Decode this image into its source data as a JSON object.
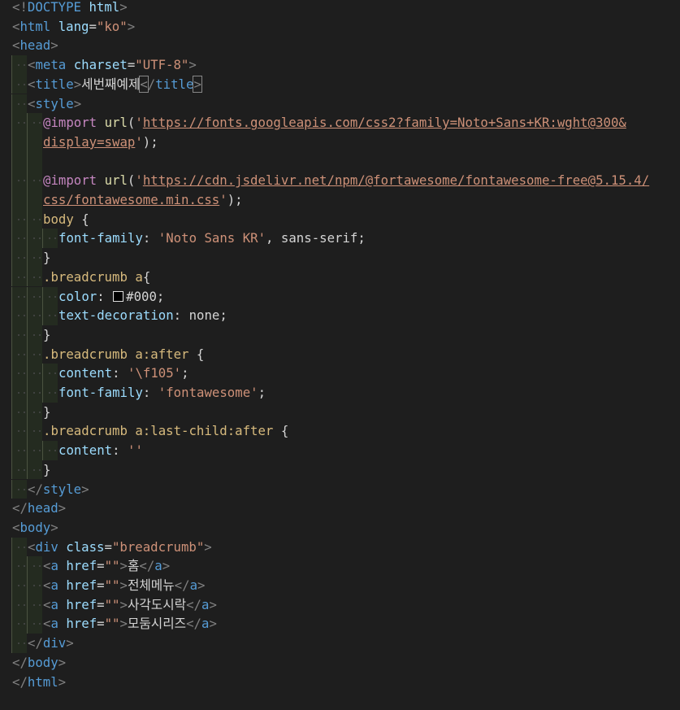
{
  "editor": {
    "language": "html",
    "theme_background": "#1e1e1e",
    "colors": {
      "tag": "#569cd6",
      "attribute": "#9cdcfe",
      "string": "#ce9178",
      "at_rule": "#c586c0",
      "function": "#dcdcaa",
      "selector": "#d7ba7d",
      "punctuation": "#808080"
    },
    "lines": [
      {
        "indent": 0,
        "tokens": [
          [
            "p",
            "<!"
          ],
          [
            "t",
            "DOCTYPE"
          ],
          [
            "x",
            " "
          ],
          [
            "a",
            "html"
          ],
          [
            "p",
            ">"
          ]
        ]
      },
      {
        "indent": 0,
        "tokens": [
          [
            "p",
            "<"
          ],
          [
            "t",
            "html"
          ],
          [
            "x",
            " "
          ],
          [
            "a",
            "lang"
          ],
          [
            "x",
            "="
          ],
          [
            "s",
            "\"ko\""
          ],
          [
            "p",
            ">"
          ]
        ]
      },
      {
        "indent": 0,
        "tokens": [
          [
            "p",
            "<"
          ],
          [
            "t",
            "head"
          ],
          [
            "p",
            ">"
          ]
        ]
      },
      {
        "indent": 1,
        "tokens": [
          [
            "p",
            "<"
          ],
          [
            "t",
            "meta"
          ],
          [
            "x",
            " "
          ],
          [
            "a",
            "charset"
          ],
          [
            "x",
            "="
          ],
          [
            "s",
            "\"UTF-8\""
          ],
          [
            "p",
            ">"
          ]
        ]
      },
      {
        "indent": 1,
        "tokens": [
          [
            "p",
            "<"
          ],
          [
            "t",
            "title"
          ],
          [
            "p",
            ">"
          ],
          [
            "x",
            "세번째예제"
          ],
          [
            "pb",
            "<"
          ],
          [
            "p",
            "/"
          ],
          [
            "t",
            "title"
          ],
          [
            "pb",
            ">"
          ],
          [
            "cur",
            ""
          ]
        ]
      },
      {
        "indent": 1,
        "tokens": [
          [
            "p",
            "<"
          ],
          [
            "t",
            "style"
          ],
          [
            "p",
            ">"
          ]
        ]
      },
      {
        "indent": 2,
        "tokens": [
          [
            "k",
            "@import"
          ],
          [
            "x",
            " "
          ],
          [
            "f",
            "url"
          ],
          [
            "x",
            "("
          ],
          [
            "s",
            "'"
          ],
          [
            "su",
            "https://fonts.googleapis.com/css2?family=Noto+Sans+KR:wght@300&"
          ]
        ]
      },
      {
        "indent": 2,
        "wrap": true,
        "tokens": [
          [
            "su",
            "display=swap"
          ],
          [
            "s",
            "'"
          ],
          [
            "x",
            ");"
          ]
        ]
      },
      {
        "indent": 2,
        "empty": true,
        "tokens": []
      },
      {
        "indent": 2,
        "tokens": [
          [
            "k",
            "@import"
          ],
          [
            "x",
            " "
          ],
          [
            "f",
            "url"
          ],
          [
            "x",
            "("
          ],
          [
            "s",
            "'"
          ],
          [
            "su",
            "https://cdn.jsdelivr.net/npm/@fortawesome/fontawesome-free@5.15.4/"
          ]
        ]
      },
      {
        "indent": 2,
        "wrap": true,
        "tokens": [
          [
            "su",
            "css/fontawesome.min.css"
          ],
          [
            "s",
            "'"
          ],
          [
            "x",
            ");"
          ]
        ]
      },
      {
        "indent": 2,
        "tokens": [
          [
            "c",
            "body"
          ],
          [
            "x",
            " {"
          ]
        ]
      },
      {
        "indent": 3,
        "tokens": [
          [
            "a",
            "font-family"
          ],
          [
            "x",
            ": "
          ],
          [
            "s",
            "'Noto Sans KR'"
          ],
          [
            "x",
            ", "
          ],
          [
            "s2",
            "sans-serif"
          ],
          [
            "x",
            ";"
          ]
        ]
      },
      {
        "indent": 2,
        "tokens": [
          [
            "x",
            "}"
          ]
        ]
      },
      {
        "indent": 2,
        "tokens": [
          [
            "c",
            ".breadcrumb"
          ],
          [
            "x",
            " "
          ],
          [
            "c",
            "a"
          ],
          [
            "x",
            "{"
          ]
        ]
      },
      {
        "indent": 3,
        "tokens": [
          [
            "a",
            "color"
          ],
          [
            "x",
            ": "
          ],
          [
            "sw",
            ""
          ],
          [
            "s2",
            "#000"
          ],
          [
            "x",
            ";"
          ]
        ]
      },
      {
        "indent": 3,
        "tokens": [
          [
            "a",
            "text-decoration"
          ],
          [
            "x",
            ": "
          ],
          [
            "s2",
            "none"
          ],
          [
            "x",
            ";"
          ]
        ]
      },
      {
        "indent": 2,
        "tokens": [
          [
            "x",
            "}"
          ]
        ]
      },
      {
        "indent": 2,
        "tokens": [
          [
            "c",
            ".breadcrumb"
          ],
          [
            "x",
            " "
          ],
          [
            "c",
            "a:after"
          ],
          [
            "x",
            " {"
          ]
        ]
      },
      {
        "indent": 3,
        "tokens": [
          [
            "a",
            "content"
          ],
          [
            "x",
            ": "
          ],
          [
            "s",
            "'\\f105'"
          ],
          [
            "x",
            ";"
          ]
        ]
      },
      {
        "indent": 3,
        "tokens": [
          [
            "a",
            "font-family"
          ],
          [
            "x",
            ": "
          ],
          [
            "s",
            "'fontawesome'"
          ],
          [
            "x",
            ";"
          ]
        ]
      },
      {
        "indent": 2,
        "tokens": [
          [
            "x",
            "}"
          ]
        ]
      },
      {
        "indent": 2,
        "tokens": [
          [
            "c",
            ".breadcrumb"
          ],
          [
            "x",
            " "
          ],
          [
            "c",
            "a:last-child:after"
          ],
          [
            "x",
            " {"
          ]
        ]
      },
      {
        "indent": 3,
        "tokens": [
          [
            "a",
            "content"
          ],
          [
            "x",
            ": "
          ],
          [
            "s",
            "''"
          ]
        ]
      },
      {
        "indent": 2,
        "tokens": [
          [
            "x",
            "}"
          ]
        ]
      },
      {
        "indent": 1,
        "tokens": [
          [
            "p",
            "</"
          ],
          [
            "t",
            "style"
          ],
          [
            "p",
            ">"
          ]
        ]
      },
      {
        "indent": 0,
        "tokens": [
          [
            "p",
            "</"
          ],
          [
            "t",
            "head"
          ],
          [
            "p",
            ">"
          ]
        ]
      },
      {
        "indent": 0,
        "tokens": [
          [
            "p",
            "<"
          ],
          [
            "t",
            "body"
          ],
          [
            "p",
            ">"
          ]
        ]
      },
      {
        "indent": 1,
        "tokens": [
          [
            "p",
            "<"
          ],
          [
            "t",
            "div"
          ],
          [
            "x",
            " "
          ],
          [
            "a",
            "class"
          ],
          [
            "x",
            "="
          ],
          [
            "s",
            "\"breadcrumb\""
          ],
          [
            "p",
            ">"
          ]
        ]
      },
      {
        "indent": 2,
        "tokens": [
          [
            "p",
            "<"
          ],
          [
            "t",
            "a"
          ],
          [
            "x",
            " "
          ],
          [
            "a",
            "href"
          ],
          [
            "x",
            "="
          ],
          [
            "s",
            "\"\""
          ],
          [
            "p",
            ">"
          ],
          [
            "x",
            "홈"
          ],
          [
            "p",
            "</"
          ],
          [
            "t",
            "a"
          ],
          [
            "p",
            ">"
          ]
        ]
      },
      {
        "indent": 2,
        "tokens": [
          [
            "p",
            "<"
          ],
          [
            "t",
            "a"
          ],
          [
            "x",
            " "
          ],
          [
            "a",
            "href"
          ],
          [
            "x",
            "="
          ],
          [
            "s",
            "\"\""
          ],
          [
            "p",
            ">"
          ],
          [
            "x",
            "전체메뉴"
          ],
          [
            "p",
            "</"
          ],
          [
            "t",
            "a"
          ],
          [
            "p",
            ">"
          ]
        ]
      },
      {
        "indent": 2,
        "tokens": [
          [
            "p",
            "<"
          ],
          [
            "t",
            "a"
          ],
          [
            "x",
            " "
          ],
          [
            "a",
            "href"
          ],
          [
            "x",
            "="
          ],
          [
            "s",
            "\"\""
          ],
          [
            "p",
            ">"
          ],
          [
            "x",
            "사각도시락"
          ],
          [
            "p",
            "</"
          ],
          [
            "t",
            "a"
          ],
          [
            "p",
            ">"
          ]
        ]
      },
      {
        "indent": 2,
        "tokens": [
          [
            "p",
            "<"
          ],
          [
            "t",
            "a"
          ],
          [
            "x",
            " "
          ],
          [
            "a",
            "href"
          ],
          [
            "x",
            "="
          ],
          [
            "s",
            "\"\""
          ],
          [
            "p",
            ">"
          ],
          [
            "x",
            "모둠시리즈"
          ],
          [
            "p",
            "</"
          ],
          [
            "t",
            "a"
          ],
          [
            "p",
            ">"
          ]
        ]
      },
      {
        "indent": 1,
        "tokens": [
          [
            "p",
            "</"
          ],
          [
            "t",
            "div"
          ],
          [
            "p",
            ">"
          ]
        ]
      },
      {
        "indent": 0,
        "tokens": [
          [
            "p",
            "</"
          ],
          [
            "t",
            "body"
          ],
          [
            "p",
            ">"
          ]
        ]
      },
      {
        "indent": 0,
        "tokens": [
          [
            "p",
            "</"
          ],
          [
            "t",
            "html"
          ],
          [
            "p",
            ">"
          ]
        ]
      }
    ]
  }
}
